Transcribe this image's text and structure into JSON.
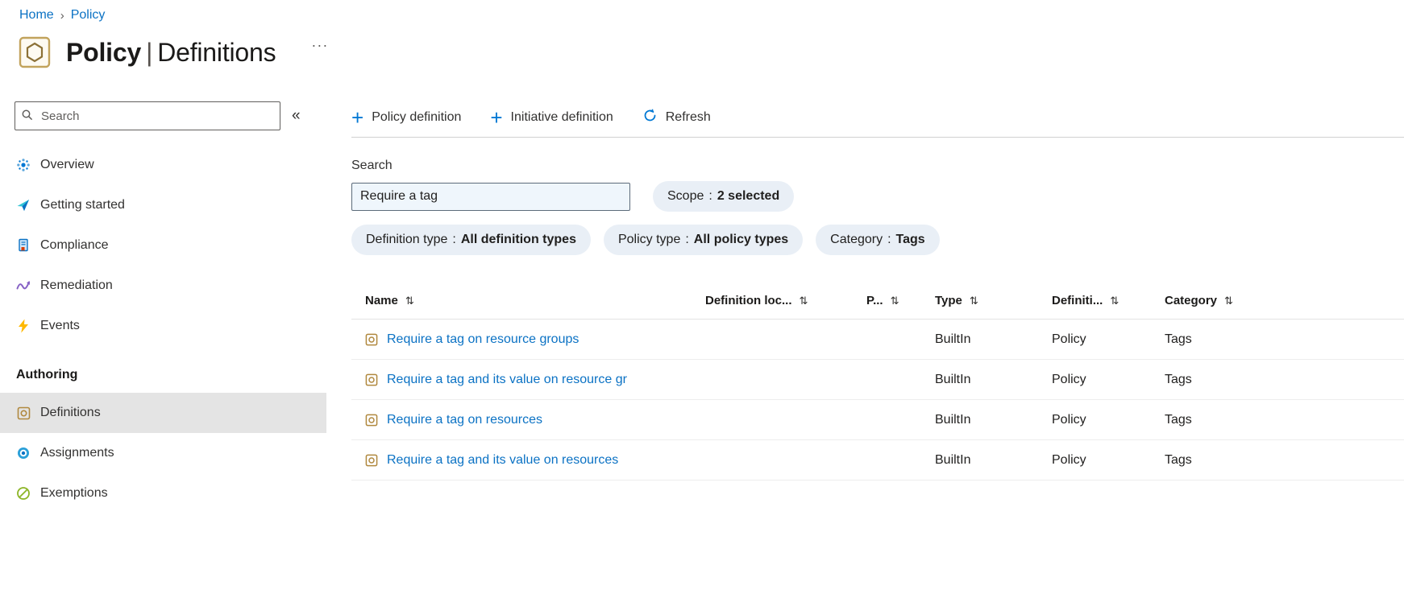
{
  "breadcrumb": {
    "separator": "›",
    "items": [
      {
        "label": "Home"
      },
      {
        "label": "Policy"
      }
    ]
  },
  "header": {
    "title_bold": "Policy",
    "title_pipe": "|",
    "title_rest": "Definitions",
    "more_label": "···"
  },
  "sidebar": {
    "search_placeholder": "Search",
    "collapse_glyph": "«",
    "items_top": [
      {
        "label": "Overview",
        "icon": "overview-icon"
      },
      {
        "label": "Getting started",
        "icon": "getting-started-icon"
      },
      {
        "label": "Compliance",
        "icon": "compliance-icon"
      },
      {
        "label": "Remediation",
        "icon": "remediation-icon"
      },
      {
        "label": "Events",
        "icon": "events-icon"
      }
    ],
    "section_header": "Authoring",
    "items_authoring": [
      {
        "label": "Definitions",
        "icon": "definitions-icon",
        "selected": true
      },
      {
        "label": "Assignments",
        "icon": "assignments-icon",
        "selected": false
      },
      {
        "label": "Exemptions",
        "icon": "exemptions-icon",
        "selected": false
      }
    ]
  },
  "toolbar": {
    "buttons": [
      {
        "label": "Policy definition",
        "icon": "plus-icon",
        "glyph": "+"
      },
      {
        "label": "Initiative definition",
        "icon": "plus-icon",
        "glyph": "+"
      },
      {
        "label": "Refresh",
        "icon": "refresh-icon"
      }
    ]
  },
  "filters": {
    "search_label": "Search",
    "search_value": "Require a tag",
    "pill_colon": ":",
    "pills": [
      {
        "name": "Scope",
        "value": "2 selected"
      },
      {
        "name": "Definition type",
        "value": "All definition types"
      },
      {
        "name": "Policy type",
        "value": "All policy types"
      },
      {
        "name": "Category",
        "value": "Tags"
      }
    ]
  },
  "table": {
    "sort_glyph": "⇅",
    "columns": [
      {
        "label": "Name"
      },
      {
        "label": "Definition loc..."
      },
      {
        "label": "P..."
      },
      {
        "label": "Type"
      },
      {
        "label": "Definiti..."
      },
      {
        "label": "Category"
      }
    ],
    "rows": [
      {
        "name": "Require a tag on resource groups",
        "definition_location": "",
        "p": "",
        "type": "BuiltIn",
        "definition_type": "Policy",
        "category": "Tags"
      },
      {
        "name": "Require a tag and its value on resource gr",
        "definition_location": "",
        "p": "",
        "type": "BuiltIn",
        "definition_type": "Policy",
        "category": "Tags"
      },
      {
        "name": "Require a tag on resources",
        "definition_location": "",
        "p": "",
        "type": "BuiltIn",
        "definition_type": "Policy",
        "category": "Tags"
      },
      {
        "name": "Require a tag and its value on resources",
        "definition_location": "",
        "p": "",
        "type": "BuiltIn",
        "definition_type": "Policy",
        "category": "Tags"
      }
    ]
  },
  "colors": {
    "accent": "#0078d4",
    "link": "#0b72c4",
    "pill_bg": "#e9eff6",
    "selected_bg": "#e4e4e4",
    "search_bg": "#eff6fc",
    "events_yellow": "#ffb900",
    "exemptions_green": "#107c10",
    "definitions_tan": "#b0883e"
  }
}
